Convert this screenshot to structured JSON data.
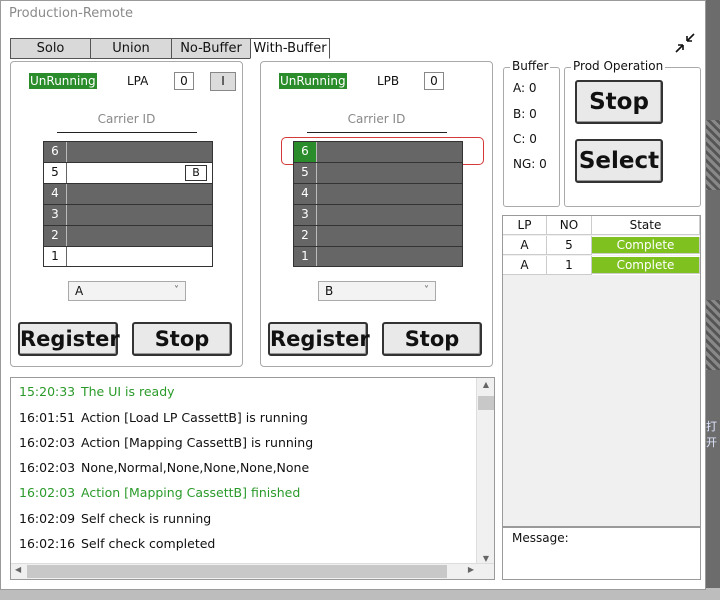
{
  "window": {
    "title": "Production-Remote"
  },
  "tabs": [
    {
      "label": "Solo",
      "active": false
    },
    {
      "label": "Union",
      "active": false
    },
    {
      "label": "No-Buffer",
      "active": false
    },
    {
      "label": "With-Buffer",
      "active": true
    }
  ],
  "lpa": {
    "status": "UnRunning",
    "name": "LPA",
    "count": "0",
    "indicator": "I",
    "carrier_label": "Carrier ID",
    "slots": [
      {
        "num": "6",
        "state": "filled"
      },
      {
        "num": "5",
        "state": "empty",
        "marker": "B"
      },
      {
        "num": "4",
        "state": "filled"
      },
      {
        "num": "3",
        "state": "filled"
      },
      {
        "num": "2",
        "state": "filled"
      },
      {
        "num": "1",
        "state": "empty"
      }
    ],
    "select_value": "A",
    "register_label": "Register",
    "stop_label": "Stop"
  },
  "lpb": {
    "status": "UnRunning",
    "name": "LPB",
    "count": "0",
    "carrier_label": "Carrier ID",
    "slots": [
      {
        "num": "6",
        "state": "active"
      },
      {
        "num": "5",
        "state": "filled"
      },
      {
        "num": "4",
        "state": "filled"
      },
      {
        "num": "3",
        "state": "filled"
      },
      {
        "num": "2",
        "state": "filled"
      },
      {
        "num": "1",
        "state": "filled"
      }
    ],
    "select_value": "B",
    "register_label": "Register",
    "stop_label": "Stop"
  },
  "buffer": {
    "title": "Buffer",
    "lines": [
      "A: 0",
      "B: 0",
      "C: 0",
      "NG: 0"
    ]
  },
  "prod_operation": {
    "title": "Prod Operation",
    "stop_label": "Stop",
    "select_label": "Select"
  },
  "state_table": {
    "headers": [
      "LP",
      "NO",
      "State"
    ],
    "rows": [
      {
        "lp": "A",
        "no": "5",
        "state": "Complete"
      },
      {
        "lp": "A",
        "no": "1",
        "state": "Complete"
      }
    ]
  },
  "message": {
    "label": "Message:"
  },
  "log": [
    {
      "time": "15:20:33",
      "text": "The UI is ready",
      "level": "success"
    },
    {
      "time": "16:01:51",
      "text": "Action [Load LP CassettB] is running",
      "level": "info"
    },
    {
      "time": "16:02:03",
      "text": "Action [Mapping CassettB] is running",
      "level": "info"
    },
    {
      "time": "16:02:03",
      "text": "None,Normal,None,None,None,None",
      "level": "info"
    },
    {
      "time": "16:02:03",
      "text": "Action [Mapping CassettB] finished",
      "level": "success"
    },
    {
      "time": "16:02:09",
      "text": "Self check is running",
      "level": "info"
    },
    {
      "time": "16:02:16",
      "text": "Self check completed",
      "level": "info"
    }
  ],
  "background": {
    "partial_text": "打开"
  },
  "colors": {
    "running_green": "#2a8c2a",
    "complete_green": "#7fc21f",
    "slot_gray": "#666666",
    "highlight_red": "#d43a3a"
  }
}
